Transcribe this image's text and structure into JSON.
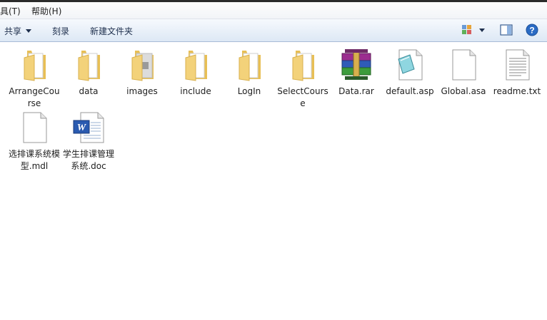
{
  "menu": {
    "tools": "具(T)",
    "help": "帮助(H)"
  },
  "toolbar": {
    "share": "共享",
    "burn": "刻录",
    "new_folder": "新建文件夹"
  },
  "files": [
    {
      "name": "ArrangeCourse",
      "type": "folder"
    },
    {
      "name": "data",
      "type": "folder"
    },
    {
      "name": "images",
      "type": "folder"
    },
    {
      "name": "include",
      "type": "folder"
    },
    {
      "name": "LogIn",
      "type": "folder"
    },
    {
      "name": "SelectCourse",
      "type": "folder"
    },
    {
      "name": "Data.rar",
      "type": "rar"
    },
    {
      "name": "default.asp",
      "type": "asp"
    },
    {
      "name": "Global.asa",
      "type": "blank"
    },
    {
      "name": "readme.txt",
      "type": "txt"
    },
    {
      "name": "选排课系统模型.mdl",
      "type": "blank"
    },
    {
      "name": "学生排课管理系统.doc",
      "type": "doc"
    }
  ],
  "colors": {
    "folder": "#f3d27a",
    "toolbar_text": "#1e2f4d",
    "help_icon": "#2a6bc4"
  }
}
